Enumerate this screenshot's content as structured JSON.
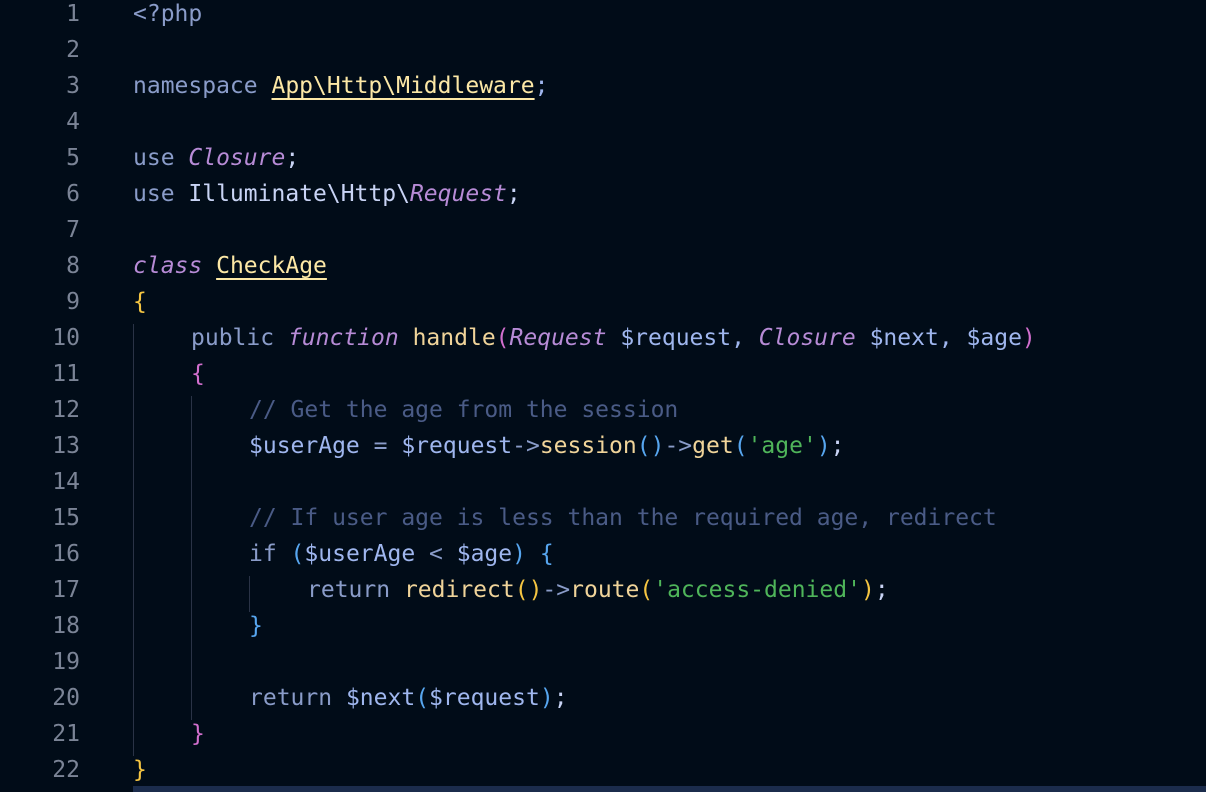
{
  "colors": {
    "background": "#010c18",
    "line_number": "#7b8496",
    "keyword": "#8a9cc9",
    "comment": "#4a5b86",
    "identifier": "#c9d4f5",
    "class_name": "#fce8a6",
    "italic_type": "#b78bd6",
    "function_name": "#f0d49a",
    "string": "#4fb55a",
    "variable": "#9fb6ee",
    "punctuation": "#9fb6ee",
    "bracket_gold": "#f5c542",
    "bracket_pink": "#d26fce",
    "bracket_blue": "#57a6ef"
  },
  "lines": [
    {
      "num": "1",
      "indent": 0,
      "tokens": [
        {
          "t": "<?php",
          "c": "keyword"
        }
      ]
    },
    {
      "num": "2",
      "indent": 0,
      "tokens": []
    },
    {
      "num": "3",
      "indent": 0,
      "tokens": [
        {
          "t": "namespace ",
          "c": "keyword"
        },
        {
          "t": "App\\Http\\Middleware",
          "c": "class_name",
          "u": true
        },
        {
          "t": ";",
          "c": "punctuation"
        }
      ]
    },
    {
      "num": "4",
      "indent": 0,
      "tokens": []
    },
    {
      "num": "5",
      "indent": 0,
      "tokens": [
        {
          "t": "use ",
          "c": "keyword"
        },
        {
          "t": "Closure",
          "c": "italic_type",
          "i": true
        },
        {
          "t": ";",
          "c": "identifier"
        }
      ]
    },
    {
      "num": "6",
      "indent": 0,
      "tokens": [
        {
          "t": "use ",
          "c": "keyword"
        },
        {
          "t": "Illuminate\\Http\\",
          "c": "identifier"
        },
        {
          "t": "Request",
          "c": "italic_type",
          "i": true
        },
        {
          "t": ";",
          "c": "identifier"
        }
      ]
    },
    {
      "num": "7",
      "indent": 0,
      "tokens": []
    },
    {
      "num": "8",
      "indent": 0,
      "tokens": [
        {
          "t": "class",
          "c": "italic_type",
          "i": true
        },
        {
          "t": " ",
          "c": "identifier"
        },
        {
          "t": "CheckAge",
          "c": "class_name",
          "u": true
        }
      ]
    },
    {
      "num": "9",
      "indent": 0,
      "tokens": [
        {
          "t": "{",
          "c": "bracket_gold"
        }
      ]
    },
    {
      "num": "10",
      "indent": 1,
      "tokens": [
        {
          "t": "public ",
          "c": "keyword"
        },
        {
          "t": "function",
          "c": "italic_type",
          "i": true
        },
        {
          "t": " ",
          "c": "identifier"
        },
        {
          "t": "handle",
          "c": "function_name"
        },
        {
          "t": "(",
          "c": "bracket_pink"
        },
        {
          "t": "Request",
          "c": "italic_type",
          "i": true
        },
        {
          "t": " $request",
          "c": "variable"
        },
        {
          "t": ", ",
          "c": "punctuation"
        },
        {
          "t": "Closure",
          "c": "italic_type",
          "i": true
        },
        {
          "t": " $next",
          "c": "variable"
        },
        {
          "t": ", ",
          "c": "punctuation"
        },
        {
          "t": "$age",
          "c": "variable"
        },
        {
          "t": ")",
          "c": "bracket_pink"
        }
      ]
    },
    {
      "num": "11",
      "indent": 1,
      "tokens": [
        {
          "t": "{",
          "c": "bracket_pink"
        }
      ]
    },
    {
      "num": "12",
      "indent": 2,
      "tokens": [
        {
          "t": "// Get the age from the session",
          "c": "comment"
        }
      ]
    },
    {
      "num": "13",
      "indent": 2,
      "tokens": [
        {
          "t": "$userAge",
          "c": "variable"
        },
        {
          "t": " = ",
          "c": "keyword"
        },
        {
          "t": "$request",
          "c": "variable"
        },
        {
          "t": "->",
          "c": "keyword"
        },
        {
          "t": "session",
          "c": "function_name"
        },
        {
          "t": "()",
          "c": "bracket_blue"
        },
        {
          "t": "->",
          "c": "keyword"
        },
        {
          "t": "get",
          "c": "function_name"
        },
        {
          "t": "(",
          "c": "bracket_blue"
        },
        {
          "t": "'age'",
          "c": "string"
        },
        {
          "t": ")",
          "c": "bracket_blue"
        },
        {
          "t": ";",
          "c": "identifier"
        }
      ]
    },
    {
      "num": "14",
      "indent": 2,
      "tokens": []
    },
    {
      "num": "15",
      "indent": 2,
      "tokens": [
        {
          "t": "// If user age is less than the required age, redirect",
          "c": "comment"
        }
      ]
    },
    {
      "num": "16",
      "indent": 2,
      "tokens": [
        {
          "t": "if ",
          "c": "keyword"
        },
        {
          "t": "(",
          "c": "bracket_blue"
        },
        {
          "t": "$userAge",
          "c": "variable"
        },
        {
          "t": " < ",
          "c": "keyword"
        },
        {
          "t": "$age",
          "c": "variable"
        },
        {
          "t": ")",
          "c": "bracket_blue"
        },
        {
          "t": " ",
          "c": "identifier"
        },
        {
          "t": "{",
          "c": "bracket_blue"
        }
      ]
    },
    {
      "num": "17",
      "indent": 3,
      "tokens": [
        {
          "t": "return ",
          "c": "keyword"
        },
        {
          "t": "redirect",
          "c": "function_name"
        },
        {
          "t": "()",
          "c": "bracket_gold"
        },
        {
          "t": "->",
          "c": "keyword"
        },
        {
          "t": "route",
          "c": "function_name"
        },
        {
          "t": "(",
          "c": "bracket_gold"
        },
        {
          "t": "'access-denied'",
          "c": "string"
        },
        {
          "t": ")",
          "c": "bracket_gold"
        },
        {
          "t": ";",
          "c": "identifier"
        }
      ]
    },
    {
      "num": "18",
      "indent": 2,
      "tokens": [
        {
          "t": "}",
          "c": "bracket_blue"
        }
      ]
    },
    {
      "num": "19",
      "indent": 2,
      "tokens": []
    },
    {
      "num": "20",
      "indent": 2,
      "tokens": [
        {
          "t": "return ",
          "c": "keyword"
        },
        {
          "t": "$next",
          "c": "variable"
        },
        {
          "t": "(",
          "c": "bracket_blue"
        },
        {
          "t": "$request",
          "c": "variable"
        },
        {
          "t": ")",
          "c": "bracket_blue"
        },
        {
          "t": ";",
          "c": "identifier"
        }
      ]
    },
    {
      "num": "21",
      "indent": 1,
      "tokens": [
        {
          "t": "}",
          "c": "bracket_pink"
        }
      ]
    },
    {
      "num": "22",
      "indent": 0,
      "tokens": [
        {
          "t": "}",
          "c": "bracket_gold"
        }
      ]
    }
  ]
}
